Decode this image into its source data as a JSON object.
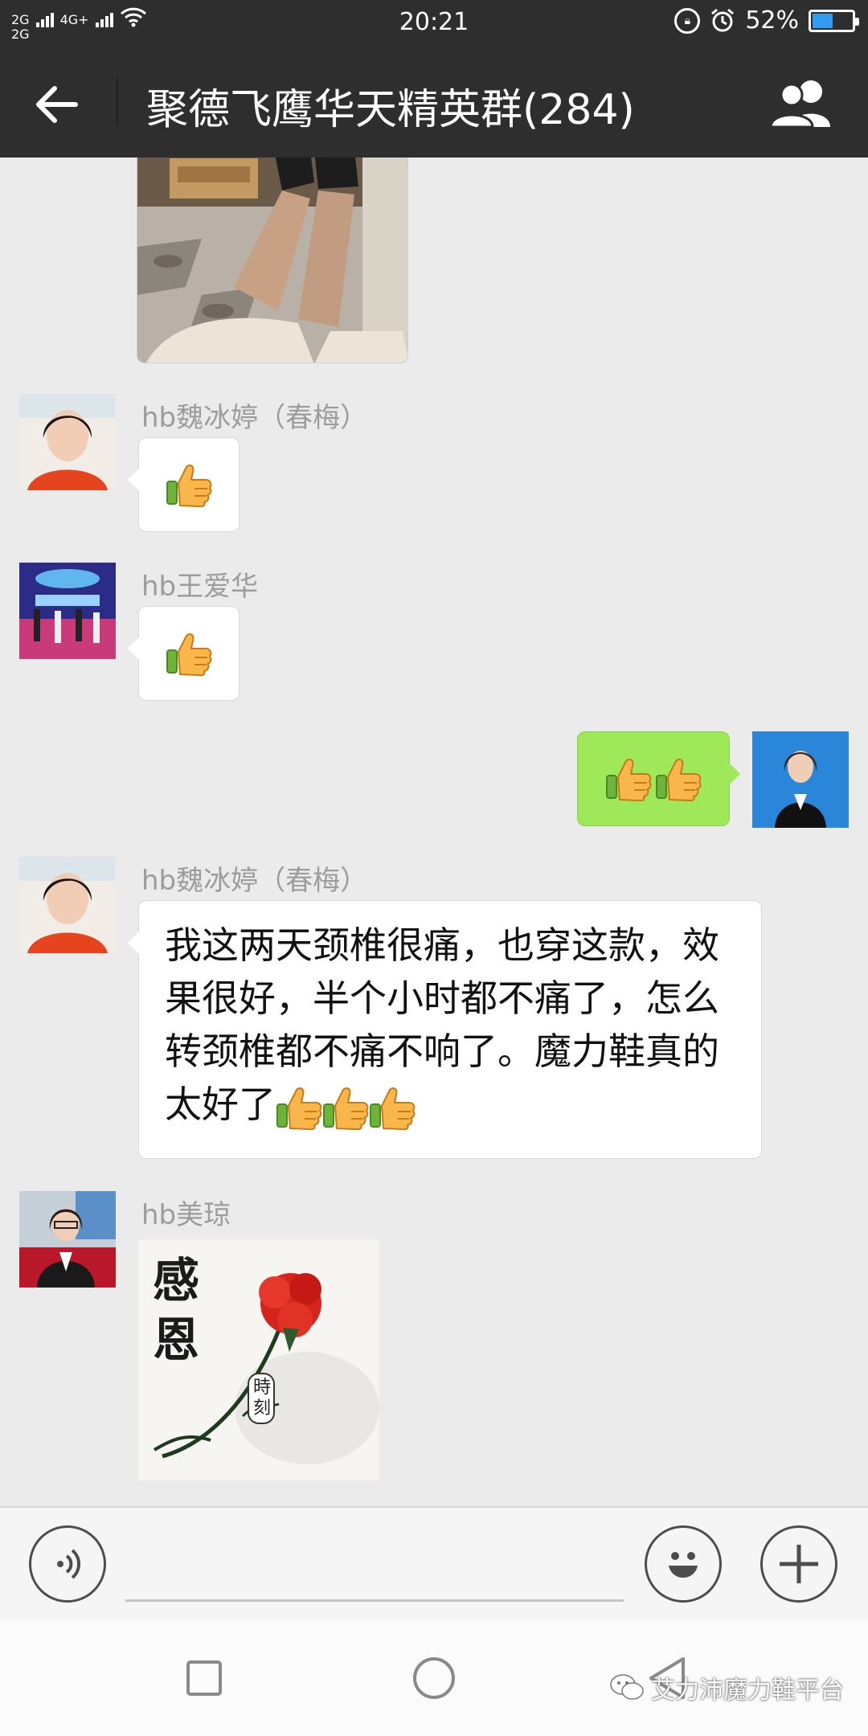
{
  "status_bar": {
    "signal_top": "2G",
    "signal_mid": "4G+",
    "signal_bottom": "2G",
    "time": "20:21",
    "battery_percent": "52%",
    "battery_level": 0.52,
    "battery_color": "#2f9cf0"
  },
  "header": {
    "title": "聚德飞鹰华天精英群(284)",
    "back_icon": "arrow-left-icon",
    "members_icon": "group-members-icon"
  },
  "messages": [
    {
      "type": "image",
      "side": "left",
      "content": "photo-shoes-legs"
    },
    {
      "type": "emoji",
      "side": "left",
      "sender": "hb魏冰婷（春梅）",
      "emoji_count": 1
    },
    {
      "type": "emoji",
      "side": "left",
      "sender": "hb王爱华",
      "emoji_count": 1
    },
    {
      "type": "emoji",
      "side": "right",
      "emoji_count": 2
    },
    {
      "type": "text",
      "side": "left",
      "sender": "hb魏冰婷（春梅）",
      "text": "我这两天颈椎很痛，也穿这款，效果很好，半个小时都不痛了，怎么转颈椎都不痛不响了。魔力鞋真的太好了",
      "emoji_count": 3
    },
    {
      "type": "sticker",
      "side": "left",
      "sender": "hb美琼",
      "sticker_text_main": "感恩",
      "sticker_text_seal": "時刻"
    }
  ],
  "colors": {
    "header_bg": "#2e2e2e",
    "chat_bg": "#ebebeb",
    "outgoing_bubble": "#9fe85a",
    "incoming_bubble": "#ffffff"
  },
  "watermark": "艾力沛魔力鞋平台"
}
